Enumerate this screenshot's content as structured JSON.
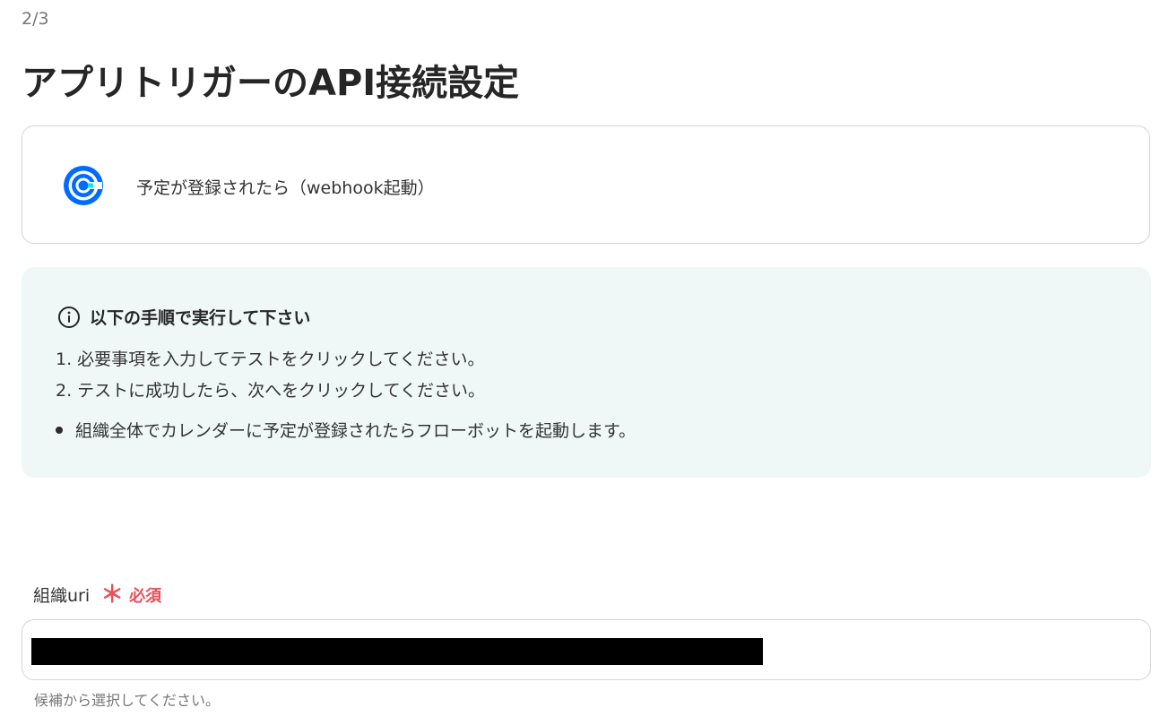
{
  "step": {
    "counter": "2/3"
  },
  "page": {
    "title": "アプリトリガーのAPI接続設定"
  },
  "app_card": {
    "logo_icon": "calendly-icon",
    "trigger_label": "予定が登録されたら（webhook起動）",
    "brand_color": "#006bff"
  },
  "instructions": {
    "icon": "info-circle-icon",
    "heading": "以下の手順で実行して下さい",
    "steps": [
      "1. 必要事項を入力してテストをクリックしてください。",
      "2. テストに成功したら、次へをクリックしてください。"
    ],
    "note": "組織全体でカレンダーに予定が登録されたらフローボットを起動します。",
    "background_color": "#f0f8f7"
  },
  "field": {
    "label": "組織uri",
    "required_mark": "＊",
    "required_text": "必須",
    "required_color": "#e8505b",
    "value": "",
    "hint": "候補から選択してください。"
  }
}
